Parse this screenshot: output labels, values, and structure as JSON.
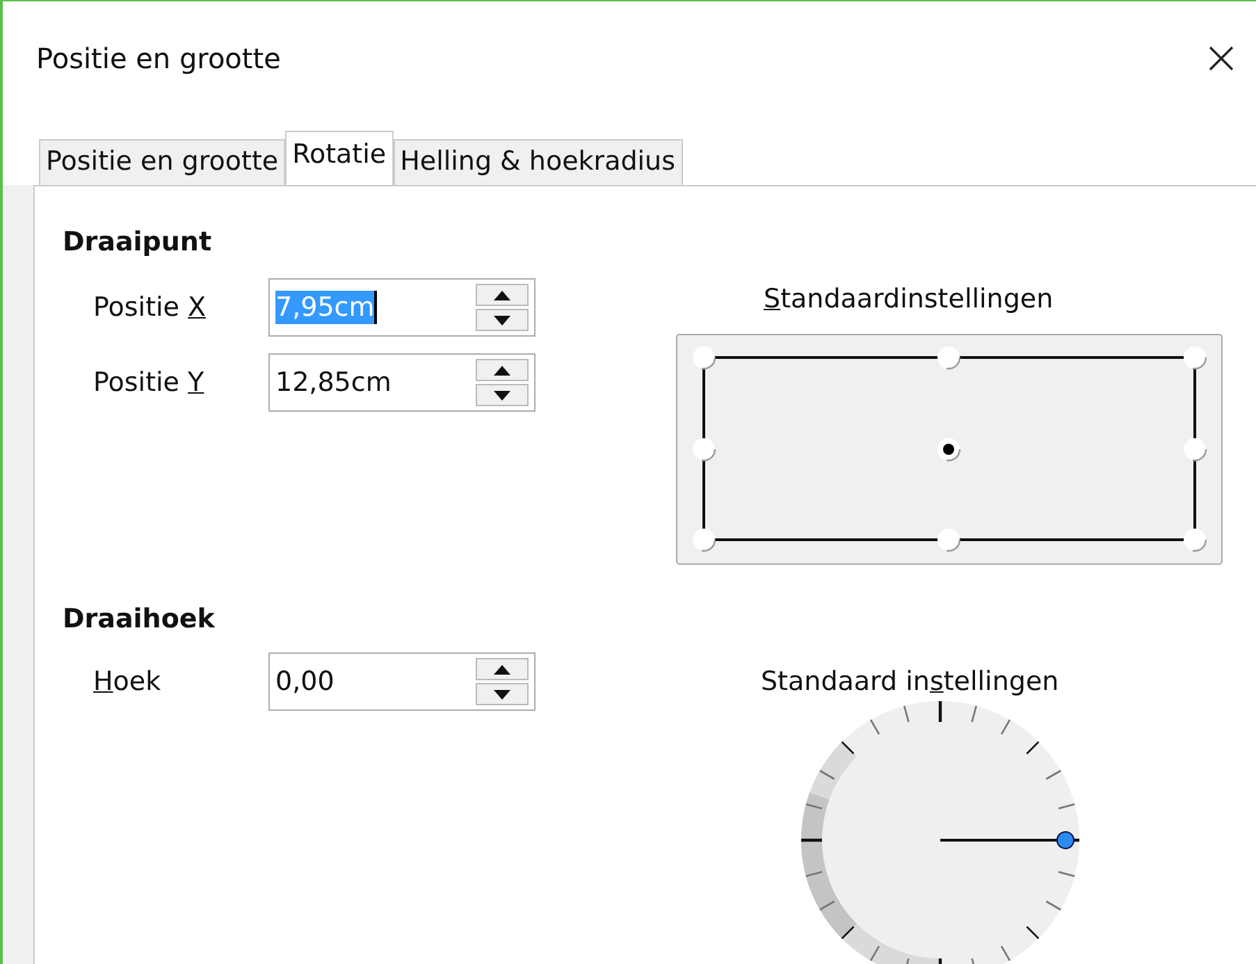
{
  "window": {
    "title": "Positie en grootte"
  },
  "tabs": [
    {
      "label": "Positie en grootte",
      "selected": false
    },
    {
      "label": "Rotatie",
      "selected": true
    },
    {
      "label": "Helling & hoekradius",
      "selected": false
    }
  ],
  "pivot": {
    "heading": "Draaipunt",
    "fields": [
      {
        "label": {
          "before": "Positie ",
          "key": "X"
        },
        "value": "7,95cm",
        "text_selected": true
      },
      {
        "label": {
          "before": "Positie ",
          "key": "Y"
        },
        "value": "12,85cm",
        "text_selected": false
      }
    ],
    "defaults_label": {
      "key": "S",
      "after": "tandaardinstellingen"
    },
    "points": [
      {
        "selected": false
      },
      {
        "selected": false
      },
      {
        "selected": false
      },
      {
        "selected": false
      },
      {
        "selected": true
      },
      {
        "selected": false
      },
      {
        "selected": false
      },
      {
        "selected": false
      },
      {
        "selected": false
      }
    ]
  },
  "angle": {
    "heading": "Draaihoek",
    "fields": [
      {
        "label": {
          "key": "H",
          "after": "oek"
        },
        "value": "0,00",
        "text_selected": false
      }
    ],
    "defaults_label": {
      "before": "Standaard in",
      "key": "s",
      "after": "tellingen"
    }
  }
}
